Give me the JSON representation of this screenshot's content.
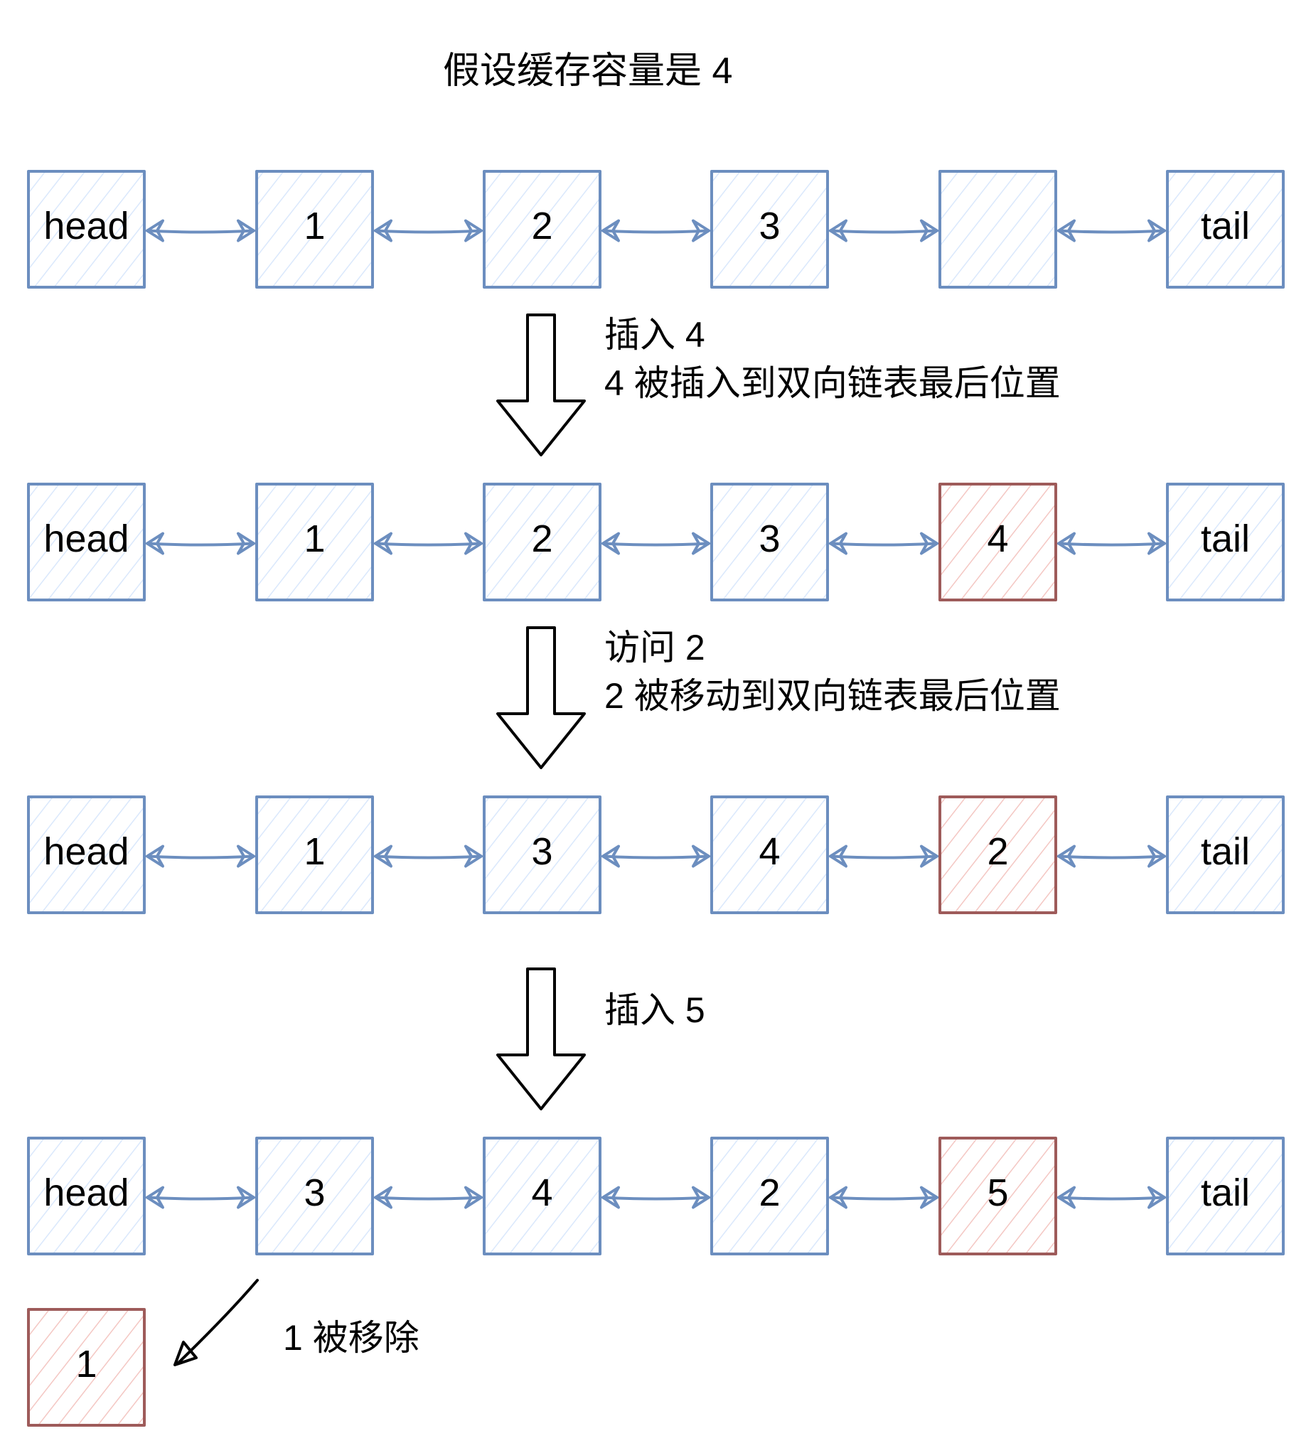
{
  "title": "假设缓存容量是 4",
  "colors": {
    "normal_stroke": "#6c8ebf",
    "normal_fill": "#dae8fc",
    "highlight_stroke": "#9e5b5a",
    "highlight_fill": "#f4c7c3",
    "arrow": "#6c8ebf",
    "text": "#000000"
  },
  "rows": [
    {
      "nodes": [
        {
          "label": "head",
          "highlight": false
        },
        {
          "label": "1",
          "highlight": false
        },
        {
          "label": "2",
          "highlight": false
        },
        {
          "label": "3",
          "highlight": false
        },
        {
          "label": "",
          "highlight": false
        },
        {
          "label": "tail",
          "highlight": false
        }
      ]
    },
    {
      "nodes": [
        {
          "label": "head",
          "highlight": false
        },
        {
          "label": "1",
          "highlight": false
        },
        {
          "label": "2",
          "highlight": false
        },
        {
          "label": "3",
          "highlight": false
        },
        {
          "label": "4",
          "highlight": true
        },
        {
          "label": "tail",
          "highlight": false
        }
      ]
    },
    {
      "nodes": [
        {
          "label": "head",
          "highlight": false
        },
        {
          "label": "1",
          "highlight": false
        },
        {
          "label": "3",
          "highlight": false
        },
        {
          "label": "4",
          "highlight": false
        },
        {
          "label": "2",
          "highlight": true
        },
        {
          "label": "tail",
          "highlight": false
        }
      ]
    },
    {
      "nodes": [
        {
          "label": "head",
          "highlight": false
        },
        {
          "label": "3",
          "highlight": false
        },
        {
          "label": "4",
          "highlight": false
        },
        {
          "label": "2",
          "highlight": false
        },
        {
          "label": "5",
          "highlight": true
        },
        {
          "label": "tail",
          "highlight": false
        }
      ]
    }
  ],
  "steps": [
    {
      "lines": [
        "插入 4",
        "4 被插入到双向链表最后位置"
      ]
    },
    {
      "lines": [
        "访问 2",
        "2 被移动到双向链表最后位置"
      ]
    },
    {
      "lines": [
        "插入 5"
      ]
    }
  ],
  "removed": {
    "node": {
      "label": "1",
      "highlight": true
    },
    "caption": "1 被移除"
  }
}
